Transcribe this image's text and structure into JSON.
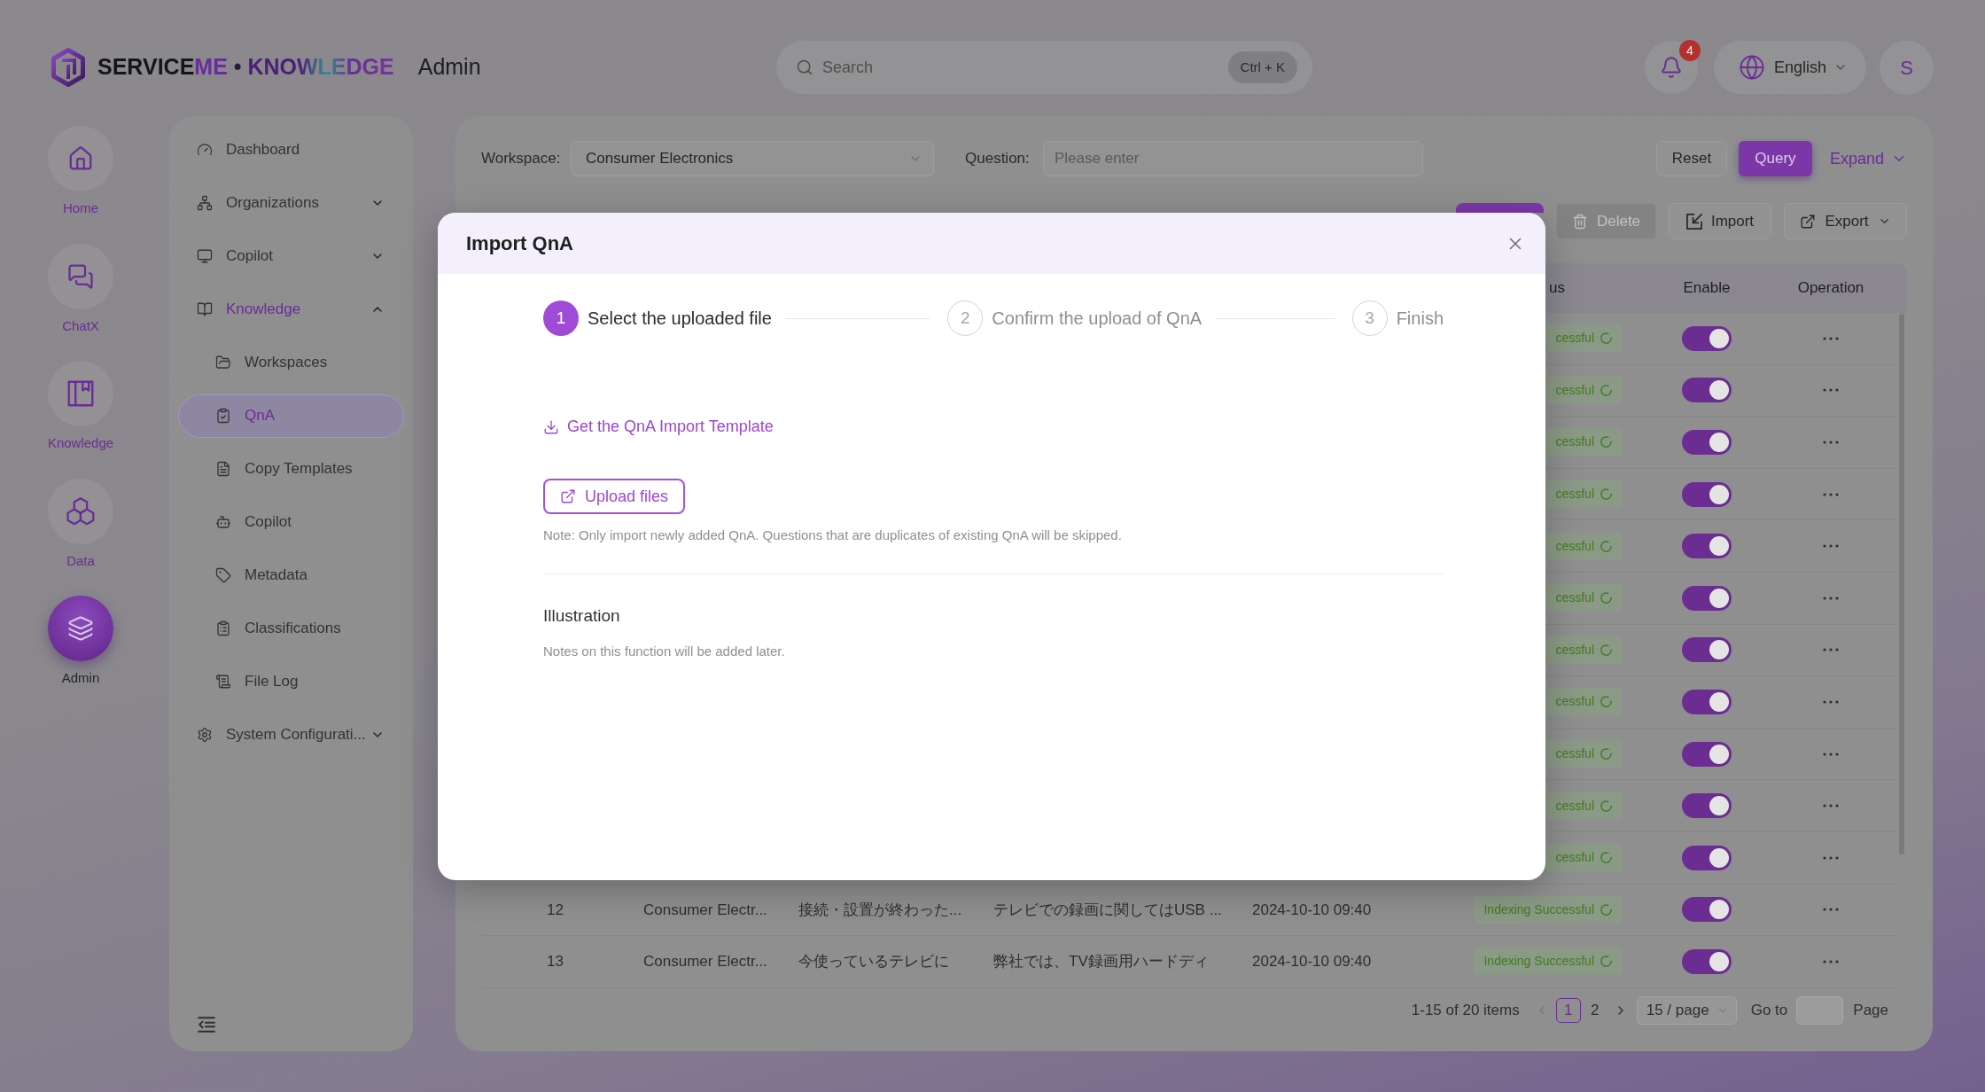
{
  "header": {
    "logo_text": "SERVICEME • KNOWLEDGE",
    "title": "Admin",
    "search": {
      "placeholder": "Search",
      "shortcut": "Ctrl + K"
    },
    "notification_count": "4",
    "language": "English",
    "avatar": "S"
  },
  "rail": [
    {
      "label": "Home",
      "selected": false
    },
    {
      "label": "ChatX",
      "selected": false
    },
    {
      "label": "Knowledge",
      "selected": false
    },
    {
      "label": "Data",
      "selected": false
    },
    {
      "label": "Admin",
      "selected": true
    }
  ],
  "nav": [
    {
      "label": "Dashboard",
      "kind": "link",
      "selected": false
    },
    {
      "label": "Organizations",
      "kind": "group",
      "selected": false,
      "expanded": false
    },
    {
      "label": "Copilot",
      "kind": "group",
      "selected": false,
      "expanded": false
    },
    {
      "label": "Knowledge",
      "kind": "group",
      "selected": false,
      "expanded": true,
      "children": [
        {
          "label": "Workspaces",
          "selected": false
        },
        {
          "label": "QnA",
          "selected": true
        },
        {
          "label": "Copy Templates",
          "selected": false
        },
        {
          "label": "Copilot",
          "selected": false
        },
        {
          "label": "Metadata",
          "selected": false
        },
        {
          "label": "Classifications",
          "selected": false
        },
        {
          "label": "File Log",
          "selected": false
        }
      ]
    },
    {
      "label": "System Configurati...",
      "kind": "group",
      "selected": false,
      "expanded": false
    }
  ],
  "filters": [
    {
      "label": "Workspace:",
      "kind": "select",
      "value": "Consumer Electronics"
    },
    {
      "label": "Question:",
      "kind": "input",
      "placeholder": "Please enter"
    }
  ],
  "filter_actions": {
    "reset": "Reset",
    "query": "Query",
    "expand": "Expand"
  },
  "toolbar": [
    {
      "label": "Delete",
      "kind": "button",
      "disabled": true
    },
    {
      "label": "Import",
      "kind": "button",
      "disabled": false
    },
    {
      "label": "Export",
      "kind": "dropdown",
      "disabled": false
    }
  ],
  "table": {
    "columns": {
      "status": "us",
      "enable": "Enable",
      "operation": "Operation"
    },
    "rows": [
      {
        "status": "cessful",
        "enabled": true
      },
      {
        "status": "cessful",
        "enabled": true
      },
      {
        "status": "cessful",
        "enabled": true
      },
      {
        "status": "cessful",
        "enabled": true
      },
      {
        "status": "cessful",
        "enabled": true
      },
      {
        "status": "cessful",
        "enabled": true
      },
      {
        "status": "cessful",
        "enabled": true
      },
      {
        "status": "cessful",
        "enabled": true
      },
      {
        "status": "cessful",
        "enabled": true
      },
      {
        "status": "cessful",
        "enabled": true
      },
      {
        "status": "cessful",
        "enabled": true
      },
      {
        "no": "12",
        "workspace": "Consumer Electr...",
        "question": "接続・設置が終わった...",
        "answer": "テレビでの録画に関してはUSB ...",
        "time": "2024-10-10 09:40",
        "status": "Indexing Successful",
        "enabled": true
      },
      {
        "no": "13",
        "workspace": "Consumer Electr...",
        "question": "今使っているテレビに",
        "answer": "弊社では、TV録画用ハードディ",
        "time": "2024-10-10 09:40",
        "status": "Indexing Successful",
        "enabled": true
      }
    ]
  },
  "pagination": {
    "summary": "1-15 of 20 items",
    "prev_disabled": true,
    "pages": [
      {
        "label": "1",
        "selected": true
      },
      {
        "label": "2",
        "selected": false
      }
    ],
    "next_disabled": false,
    "page_size": "15 / page",
    "goto_label": "Go to",
    "page_label": "Page"
  },
  "modal": {
    "title": "Import QnA",
    "steps": [
      {
        "number": "1",
        "label": "Select the uploaded file",
        "current": true
      },
      {
        "number": "2",
        "label": "Confirm the upload of QnA",
        "current": false
      },
      {
        "number": "3",
        "label": "Finish",
        "current": false
      }
    ],
    "template_link": "Get the QnA Import Template",
    "upload_button": "Upload files",
    "note": "Note: Only import newly added QnA. Questions that are duplicates of existing QnA will be skipped.",
    "section_title": "Illustration",
    "section_text": "Notes on this function will be added later."
  }
}
